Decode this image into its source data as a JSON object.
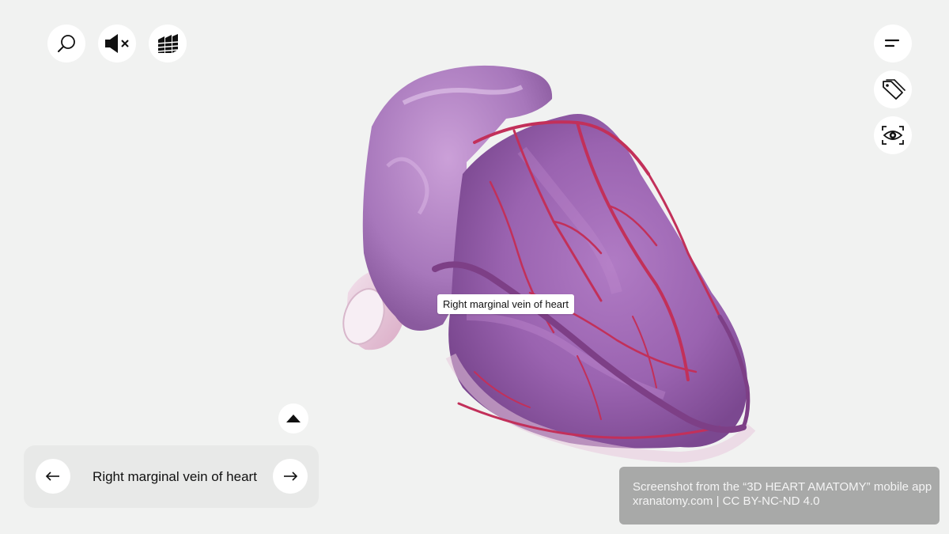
{
  "toolbar": {
    "left_icons": [
      "search-icon",
      "sound-muted-icon",
      "layers-icon"
    ],
    "right_icons": [
      "menu-icon",
      "tag-icon",
      "eye-view-icon"
    ]
  },
  "viewer": {
    "model": "3D heart",
    "hotspot_label": "Right marginal vein of heart"
  },
  "structure_nav": {
    "expand_icon": "triangle-up-icon",
    "prev_icon": "arrow-left-icon",
    "next_icon": "arrow-right-icon",
    "current_structure": "Right marginal vein of heart"
  },
  "credit": {
    "line1": "Screenshot from the “3D HEART AMATOMY” mobile app",
    "line2": "xranatomy.com | CC BY-NC-ND 4.0"
  },
  "colors": {
    "background": "#f1f2f1",
    "heart_surface": "#a56ab8",
    "vessels": "#c2305a",
    "credit_box": "#a8a9a8"
  }
}
